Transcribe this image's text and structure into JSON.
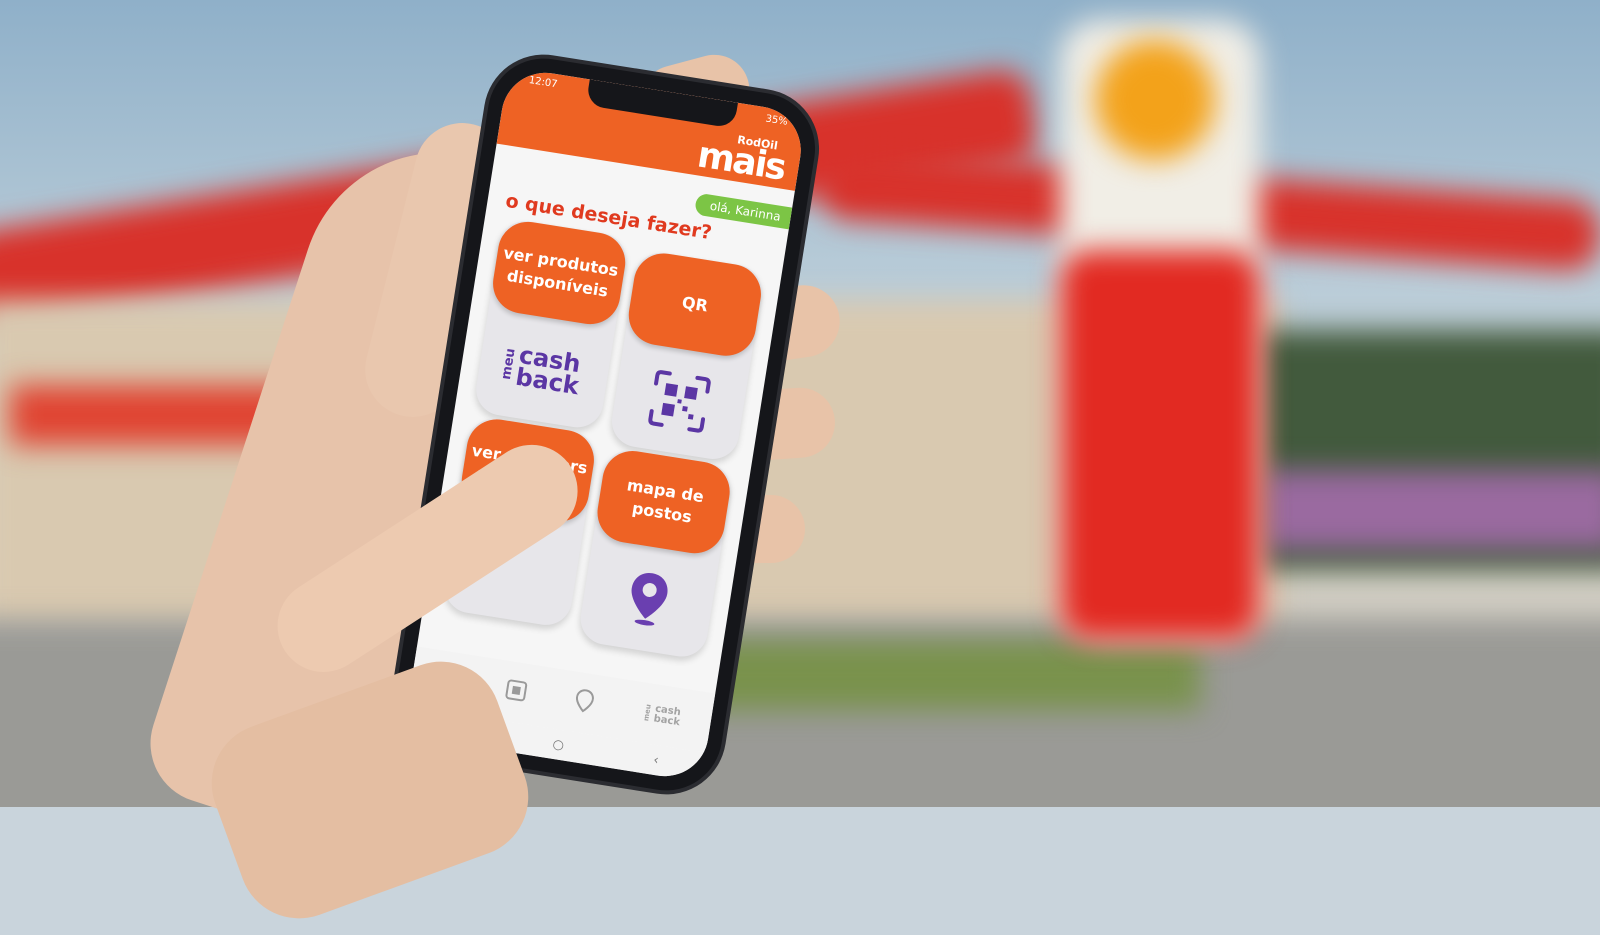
{
  "status_bar": {
    "time": "12:07",
    "battery": "35%"
  },
  "brand": {
    "small": "RodOil",
    "big": "mais"
  },
  "greeting": "olá, Karinna",
  "question": "o que deseja fazer?",
  "tiles": [
    {
      "label": "ver produtos disponíveis",
      "icon": "meu-cashback-icon",
      "icon_text_meu": "meu",
      "icon_text_main": "cash back"
    },
    {
      "label": "QR",
      "icon": "qr-code-icon"
    },
    {
      "label": "ver vouchers disponíveis",
      "icon": "percent-icon"
    },
    {
      "label": "mapa de postos",
      "icon": "map-pin-icon"
    }
  ],
  "tabbar": [
    {
      "icon": "percent-icon"
    },
    {
      "icon": "qr-code-icon"
    },
    {
      "icon": "map-pin-icon"
    },
    {
      "icon": "meu-cashback-icon",
      "text_meu": "meu",
      "text_main": "cash back"
    }
  ],
  "navbar": [
    {
      "icon": "recents-icon"
    },
    {
      "icon": "home-icon"
    },
    {
      "icon": "back-icon"
    }
  ],
  "colors": {
    "brand_orange": "#ee6224",
    "greeting_green": "#7cc545",
    "question_red": "#e03a1f",
    "icon_purple": "#5b36a4"
  }
}
